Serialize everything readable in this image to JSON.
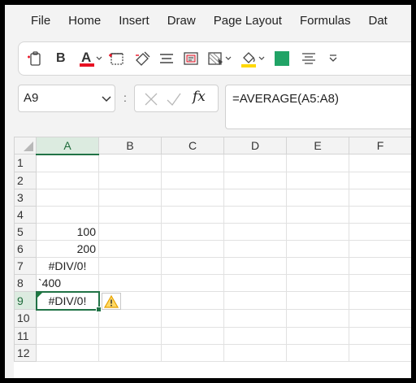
{
  "menu": {
    "items": [
      "File",
      "Home",
      "Insert",
      "Draw",
      "Page Layout",
      "Formulas",
      "Dat"
    ]
  },
  "ribbon": {
    "bold_label": "B",
    "font_color": "#e81123",
    "highlight_color": "#ffd800",
    "fill_color": "#21a366",
    "icons": [
      "paste-icon",
      "bold-icon",
      "font-color-icon",
      "borders-icon",
      "format-painter-icon",
      "align-icon",
      "wrap-text-icon",
      "conditional-format-icon",
      "fill-color-icon",
      "fill-square-icon",
      "align-center-icon",
      "more-icon"
    ]
  },
  "formula_bar": {
    "name_box": "A9",
    "more": ":",
    "fx_label": "fx",
    "formula": "=AVERAGE(A5:A8)"
  },
  "sheet": {
    "columns": [
      "A",
      "B",
      "C",
      "D",
      "E",
      "F"
    ],
    "selected_column": "A",
    "selected_row": "9",
    "rows": [
      {
        "num": "1",
        "a": ""
      },
      {
        "num": "2",
        "a": ""
      },
      {
        "num": "3",
        "a": ""
      },
      {
        "num": "4",
        "a": ""
      },
      {
        "num": "5",
        "a": "100"
      },
      {
        "num": "6",
        "a": "200"
      },
      {
        "num": "7",
        "a": "#DIV/0!"
      },
      {
        "num": "8",
        "a": "`400"
      },
      {
        "num": "9",
        "a": "#DIV/0!"
      },
      {
        "num": "10",
        "a": ""
      },
      {
        "num": "11",
        "a": ""
      },
      {
        "num": "12",
        "a": ""
      }
    ],
    "accent_color": "#217346",
    "warning_color": "#e8a200"
  }
}
